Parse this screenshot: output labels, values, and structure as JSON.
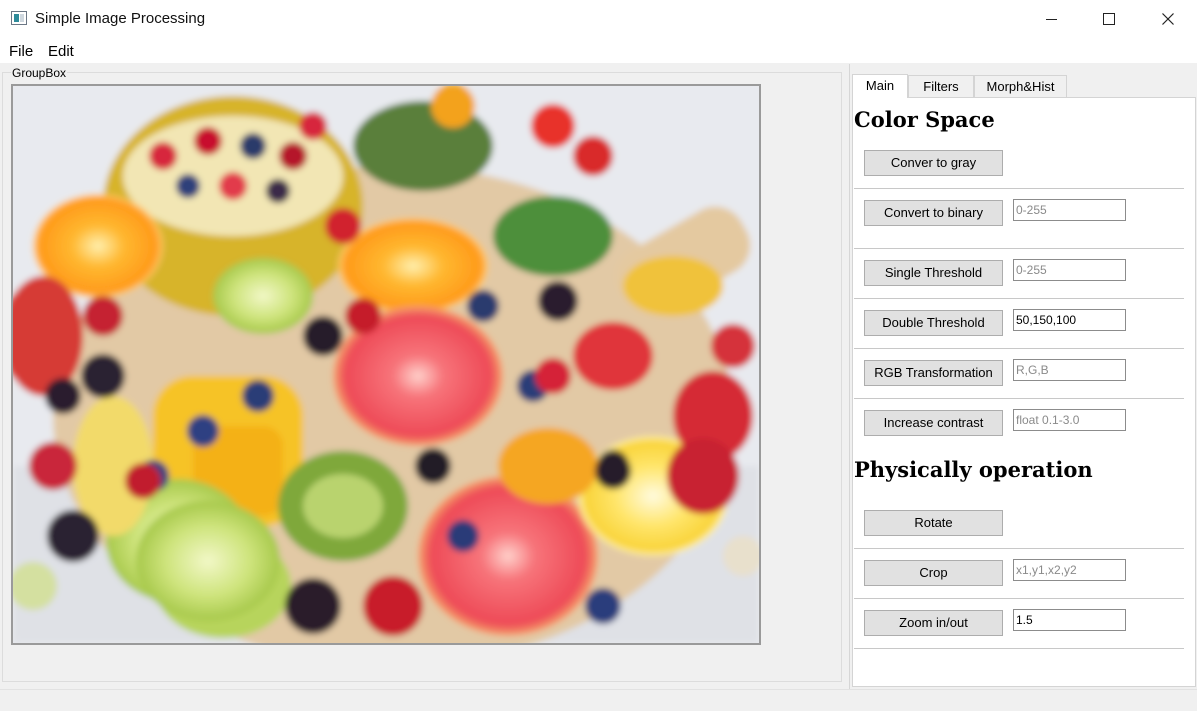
{
  "window": {
    "title": "Simple Image Processing",
    "app_icon": "image-app-icon",
    "controls": [
      "minimize-icon",
      "maximize-icon",
      "close-icon"
    ]
  },
  "menubar": {
    "file": "File",
    "edit": "Edit"
  },
  "groupbox": {
    "title": "GroupBox",
    "image_alt": "fruit platter photo"
  },
  "tabs": [
    {
      "label": "Main",
      "active": true
    },
    {
      "label": "Filters",
      "active": false
    },
    {
      "label": "Morph&Hist",
      "active": false
    }
  ],
  "color_space": {
    "heading": "Color Space",
    "gray_button": "Conver to gray",
    "binary_button": "Convert to binary",
    "binary_placeholder": "0-255",
    "single_button": "Single Threshold",
    "single_placeholder": "0-255",
    "double_button": "Double Threshold",
    "double_value": "50,150,100",
    "rgb_button": "RGB Transformation",
    "rgb_placeholder": "R,G,B",
    "contrast_button": "Increase contrast",
    "contrast_placeholder": "float 0.1-3.0"
  },
  "physical": {
    "heading": "Physically operation",
    "rotate_button": "Rotate",
    "crop_button": "Crop",
    "crop_placeholder": "x1,y1,x2,y2",
    "zoom_button": "Zoom in/out",
    "zoom_value": "1.5"
  },
  "colors": {
    "button_bg": "#e1e1e1",
    "window_bg": "#f0f0f0"
  }
}
